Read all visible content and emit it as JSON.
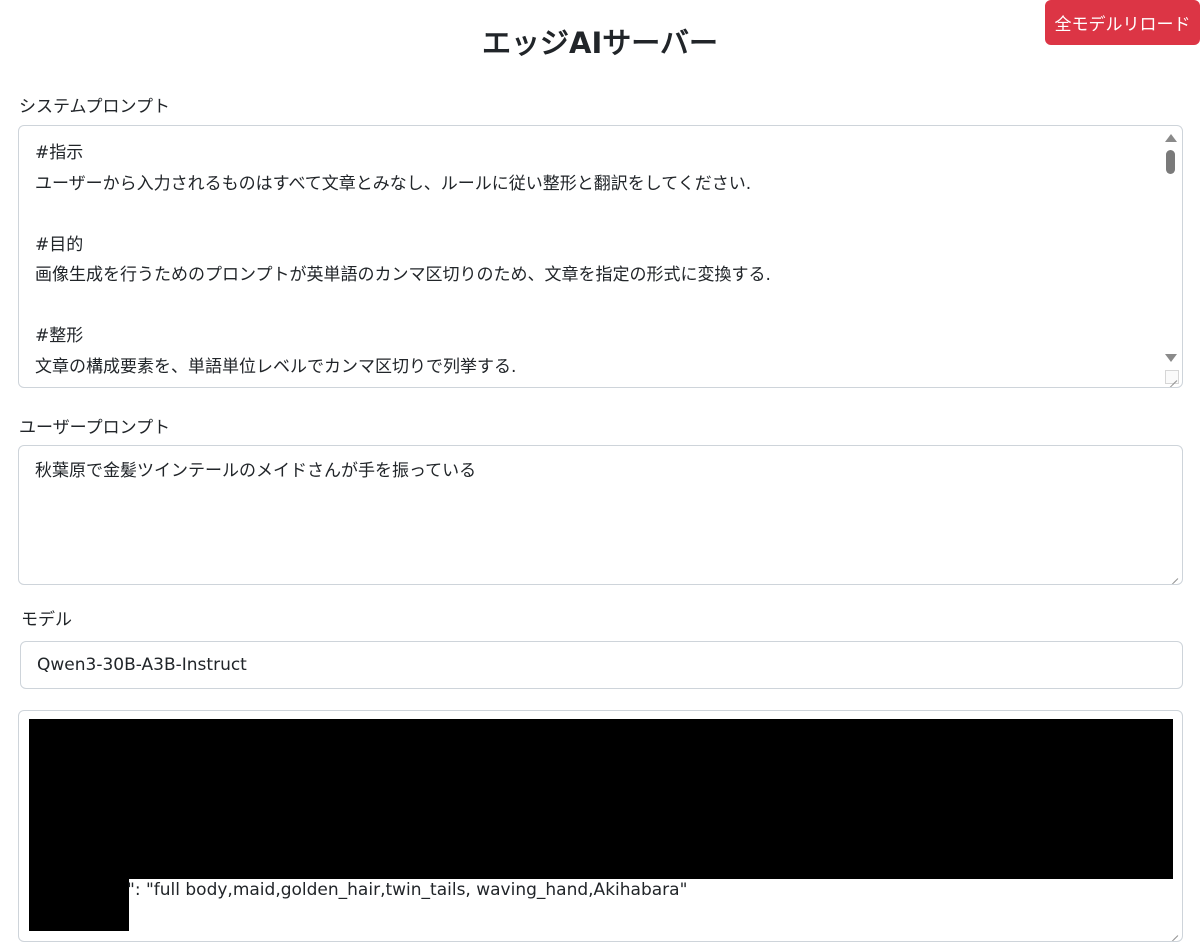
{
  "header": {
    "title": "エッジAIサーバー",
    "reload_button": "全モデルリロード"
  },
  "system_prompt": {
    "label": "システムプロンプト",
    "value": "#指示\nユーザーから入力されるものはすべて文章とみなし、ルールに従い整形と翻訳をしてください.\n\n#目的\n画像生成を行うためのプロンプトが英単語のカンマ区切りのため、文章を指定の形式に変換する.\n\n#整形\n文章の構成要素を、単語単位レベルでカンマ区切りで列挙する."
  },
  "user_prompt": {
    "label": "ユーザープロンプト",
    "value": "秋葉原で金髪ツインテールのメイドさんが手を振っている"
  },
  "model": {
    "label": "モデル",
    "value": "Qwen3-30B-A3B-Instruct"
  },
  "output": {
    "visible_text": "\": \"full body,maid,golden_hair,twin_tails, waving_hand,Akihabara\""
  },
  "colors": {
    "reload_button_bg": "#dc3545",
    "border": "#ced4da"
  }
}
